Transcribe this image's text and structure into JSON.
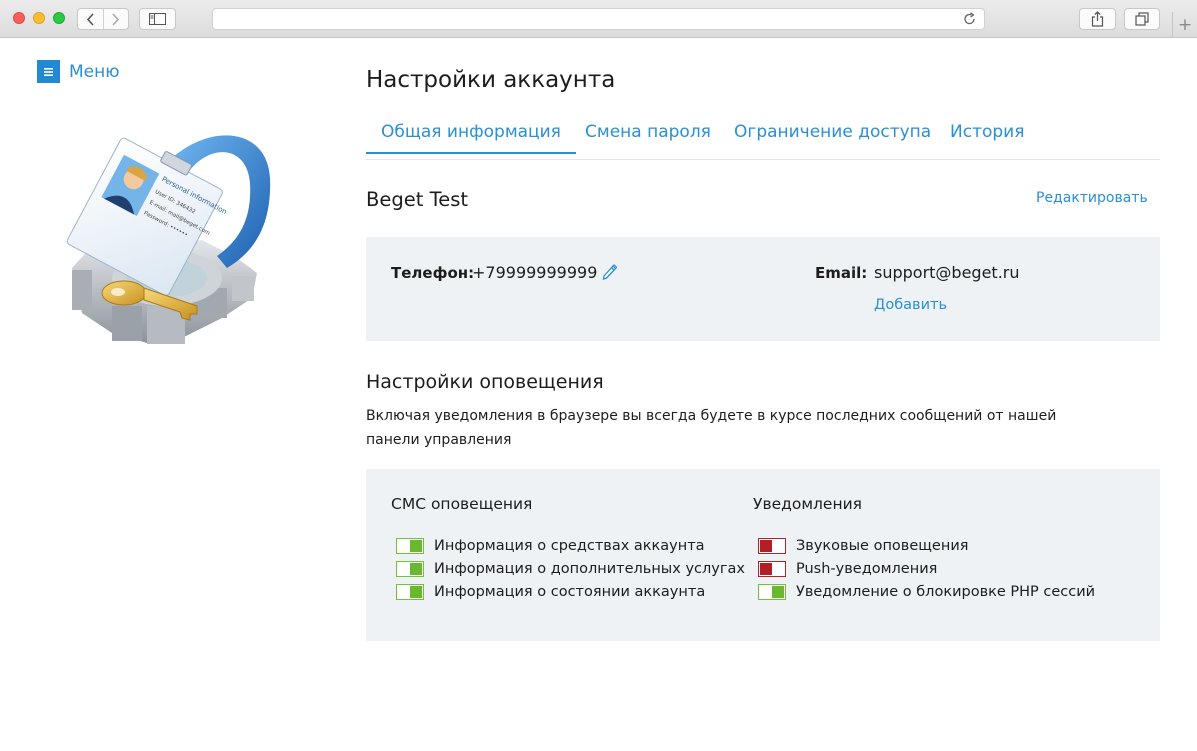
{
  "browser": {
    "nav_icons": [
      "back-icon",
      "forward-icon"
    ],
    "new_tab_symbol": "+"
  },
  "sidebar": {
    "menu_label": "Меню",
    "card_texts": [
      "Personal information",
      "User ID: 346432",
      "E-mail: mail@beget.com",
      "Password: ••••••"
    ]
  },
  "page": {
    "title": "Настройки аккаунта"
  },
  "tabs": [
    {
      "label": "Общая информация",
      "active": true
    },
    {
      "label": "Смена пароля",
      "active": false
    },
    {
      "label": "Ограничение доступа",
      "active": false
    },
    {
      "label": "История",
      "active": false
    }
  ],
  "account": {
    "name": "Beget Test",
    "edit_label": "Редактировать",
    "phone_label": "Телефон:",
    "phone_value": "+79999999999",
    "email_label": "Email:",
    "email_value": "support@beget.ru",
    "add_label": "Добавить"
  },
  "notifications": {
    "title": "Настройки оповещения",
    "description": "Включая уведомления в браузере вы всегда будете в курсе последних сообщений от нашей панели управления",
    "sms": {
      "title": "СМС оповещения",
      "items": [
        {
          "label": "Информация о средствах аккаунта",
          "enabled": true
        },
        {
          "label": "Информация о дополнительных услугах",
          "enabled": true
        },
        {
          "label": "Информация о состоянии аккаунта",
          "enabled": true
        }
      ]
    },
    "browser": {
      "title": "Уведомления",
      "items": [
        {
          "label": "Звуковые оповещения",
          "enabled": false
        },
        {
          "label": "Push-уведомления",
          "enabled": false
        },
        {
          "label": "Уведомление о блокировке PHP сессий",
          "enabled": true
        }
      ]
    }
  },
  "colors": {
    "accent": "#2a8fd4",
    "panel_bg": "#eff2f5",
    "toggle_on": "#6ab82f",
    "toggle_off": "#b21f26"
  }
}
